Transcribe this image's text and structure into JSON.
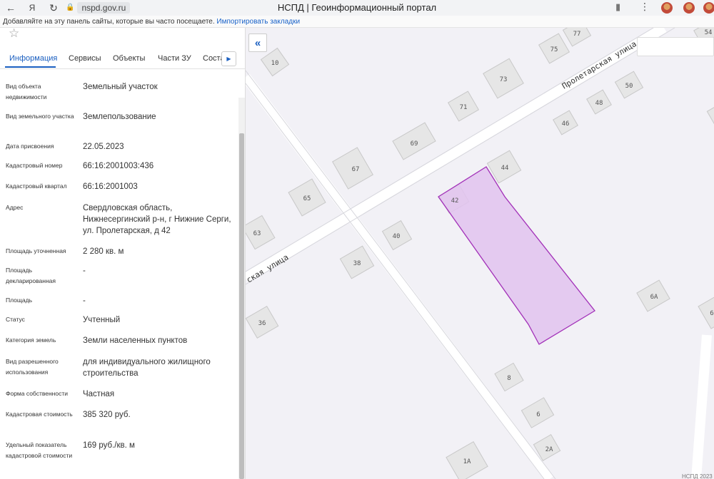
{
  "browser": {
    "url": "nspd.gov.ru",
    "title": "НСПД | Геоинформационный портал",
    "bookmarks_hint": "Добавляйте на эту панель сайты, которые вы часто посещаете.",
    "bookmarks_import": "Импортировать закладки",
    "icons": [
      "back-arrow-icon",
      "yandex-icon",
      "reload-icon",
      "lock-icon",
      "bookmark-icon",
      "more-icon",
      "extension-icon"
    ]
  },
  "panel": {
    "tabs": [
      {
        "label": "Информация",
        "active": true
      },
      {
        "label": "Сервисы"
      },
      {
        "label": "Объекты"
      },
      {
        "label": "Части ЗУ"
      },
      {
        "label": "Соста"
      }
    ],
    "rows": [
      {
        "label": "Вид объекта недвижимости",
        "value": "Земельный участок"
      },
      {
        "label": "Вид земельного участка",
        "value": "Землепользование"
      },
      {
        "label": "Дата присвоения",
        "value": "22.05.2023"
      },
      {
        "label": "Кадастровый номер",
        "value": "66:16:2001003:436"
      },
      {
        "label": "Кадастровый квартал",
        "value": "66:16:2001003"
      },
      {
        "label": "Адрес",
        "value": "Свердловская область, Нижнесергинский р-н, г Нижние Серги, ул. Пролетарская, д 42"
      },
      {
        "label": "Площадь уточненная",
        "value": "2 280 кв. м"
      },
      {
        "label": "Площадь декларированная",
        "value": "-"
      },
      {
        "label": "Площадь",
        "value": "-"
      },
      {
        "label": "Статус",
        "value": "Учтенный"
      },
      {
        "label": "Категория земель",
        "value": "Земли населенных пунктов"
      },
      {
        "label": "Вид разрешенного использования",
        "value": "для индивидуального жилищного строительства"
      },
      {
        "label": "Форма собственности",
        "value": "Частная"
      },
      {
        "label": "Кадастровая стоимость",
        "value": "385 320 руб."
      },
      {
        "label": "Удельный показатель кадастровой стоимости",
        "value": "169 руб./кв. м"
      }
    ]
  },
  "map": {
    "street_upper": "Пролетарская улица",
    "street_lower": "ская улица",
    "copyright": "НСПД 2023",
    "buildings": [
      "10",
      "77",
      "75",
      "73",
      "54",
      "50",
      "48",
      "71",
      "46",
      "69",
      "67",
      "44",
      "65",
      "42",
      "63",
      "40",
      "38",
      "6А",
      "36",
      "6",
      "8",
      "6",
      "2А",
      "1А"
    ],
    "parcel_color": "#e2c3ef",
    "parcel_stroke": "#a230b8"
  }
}
